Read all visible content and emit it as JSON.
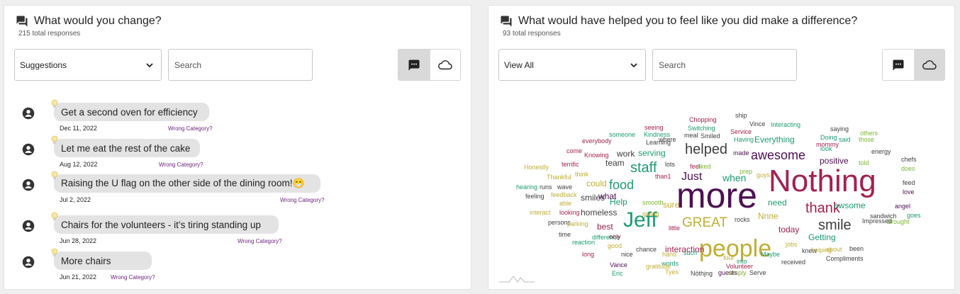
{
  "left_panel": {
    "title": "What would you change?",
    "subtitle": "215 total responses",
    "category_select": "Suggestions",
    "search_placeholder": "Search",
    "view_toggle": {
      "active": "list-view",
      "options": [
        "chat-bubble-icon",
        "cloud-icon"
      ]
    },
    "responses": [
      {
        "text": "Get a second oven for efficiency",
        "date": "Dec 11, 2022",
        "action": "Wrong Category?"
      },
      {
        "text": "Let me eat the rest of the cake",
        "date": "Aug 12, 2022",
        "action": "Wrong Category?"
      },
      {
        "text": "Raising the U flag on the other side of the dining room!😁",
        "date": "Jul 2, 2022",
        "action": "Wrong Category?"
      },
      {
        "text": "Chairs for the volunteers - it’s tiring standing up",
        "date": "Jun 28, 2022",
        "action": "Wrong Category?"
      },
      {
        "text": "More chairs",
        "date": "Jun 21, 2022",
        "action": "Wrong Category?"
      }
    ]
  },
  "right_panel": {
    "title": "What would have helped you to feel like you did make a difference?",
    "subtitle": "93 total responses",
    "category_select": "View All",
    "search_placeholder": "Search",
    "view_toggle": {
      "active": "cloud-view",
      "options": [
        "chat-bubble-icon",
        "cloud-icon"
      ]
    },
    "word_cloud": [
      {
        "w": "more",
        "c": "#4d0f52"
      },
      {
        "w": "Nothing",
        "c": "#a3204f"
      },
      {
        "w": "people",
        "c": "#bfae34"
      },
      {
        "w": "Jeff",
        "c": "#1b9a73"
      },
      {
        "w": "helped",
        "c": "#3d3d3d"
      },
      {
        "w": "staff",
        "c": "#1b9a73"
      },
      {
        "w": "awesome",
        "c": "#4d0f52"
      },
      {
        "w": "food",
        "c": "#1b9a73"
      },
      {
        "w": "GREAT",
        "c": "#bfae34"
      },
      {
        "w": "thank",
        "c": "#a3204f"
      },
      {
        "w": "smile",
        "c": "#3d3d3d"
      },
      {
        "w": "Just",
        "c": "#4d0f52"
      },
      {
        "w": "when",
        "c": "#1b9a73"
      },
      {
        "w": "positive",
        "c": "#4d0f52"
      },
      {
        "w": "Everything",
        "c": "#1b9a73"
      },
      {
        "w": "work",
        "c": "#3d3d3d"
      },
      {
        "w": "serving",
        "c": "#1b9a73"
      },
      {
        "w": "team",
        "c": "#3d3d3d"
      },
      {
        "w": "could",
        "c": "#bfae34"
      },
      {
        "w": "smiles",
        "c": "#3d3d3d"
      },
      {
        "w": "homeless",
        "c": "#3d3d3d"
      },
      {
        "w": "Help",
        "c": "#1b9a73"
      },
      {
        "w": "what",
        "c": "#4d0f52"
      },
      {
        "w": "sure",
        "c": "#bfae34"
      },
      {
        "w": "best",
        "c": "#a3204f"
      },
      {
        "w": "interaction",
        "c": "#a3204f"
      },
      {
        "w": "need",
        "c": "#1b9a73"
      },
      {
        "w": "Nnne",
        "c": "#bfae34"
      },
      {
        "w": "today",
        "c": "#a3204f"
      },
      {
        "w": "awsome",
        "c": "#1b9a73"
      },
      {
        "w": "Getting",
        "c": "#1b9a73"
      },
      {
        "w": "Chopping",
        "c": "#a3204f"
      },
      {
        "w": "Switching",
        "c": "#1b9a73"
      },
      {
        "w": "seeing",
        "c": "#a3204f"
      },
      {
        "w": "someone",
        "c": "#1b9a73"
      },
      {
        "w": "Kindness",
        "c": "#1b9a73"
      },
      {
        "w": "Learning",
        "c": "#3d3d3d"
      },
      {
        "w": "where",
        "c": "#3d3d3d"
      },
      {
        "w": "meal",
        "c": "#3d3d3d"
      },
      {
        "w": "everybody",
        "c": "#a3204f"
      },
      {
        "w": "come",
        "c": "#a3204f"
      },
      {
        "w": "Knowing",
        "c": "#a3204f"
      },
      {
        "w": "Smiled",
        "c": "#3d3d3d"
      },
      {
        "w": "ship",
        "c": "#3d3d3d"
      },
      {
        "w": "Vince",
        "c": "#3d3d3d"
      },
      {
        "w": "Service",
        "c": "#a3204f"
      },
      {
        "w": "Having",
        "c": "#1b9a73"
      },
      {
        "w": "made",
        "c": "#4d0f52"
      },
      {
        "w": "Interacting",
        "c": "#1b9a73"
      },
      {
        "w": "saying",
        "c": "#3d3d3d"
      },
      {
        "w": "Doing",
        "c": "#1b9a73"
      },
      {
        "w": "mommy",
        "c": "#a3204f"
      },
      {
        "w": "others",
        "c": "#7ab530"
      },
      {
        "w": "said",
        "c": "#1b9a73"
      },
      {
        "w": "those",
        "c": "#7ab530"
      },
      {
        "w": "look",
        "c": "#1b9a73"
      },
      {
        "w": "energy",
        "c": "#3d3d3d"
      },
      {
        "w": "told",
        "c": "#7ab530"
      },
      {
        "w": "chefs",
        "c": "#3d3d3d"
      },
      {
        "w": "does",
        "c": "#7ab530"
      },
      {
        "w": "Honestly",
        "c": "#bfae34"
      },
      {
        "w": "terrific",
        "c": "#a3204f"
      },
      {
        "w": "think",
        "c": "#bfae34"
      },
      {
        "w": "Thankful",
        "c": "#bfae34"
      },
      {
        "w": "lots",
        "c": "#3d3d3d"
      },
      {
        "w": "feel",
        "c": "#a3204f"
      },
      {
        "w": "liked",
        "c": "#7ab530"
      },
      {
        "w": "than1",
        "c": "#a3204f"
      },
      {
        "w": "prep",
        "c": "#7ab530"
      },
      {
        "w": "guys",
        "c": "#bfae34"
      },
      {
        "w": "hearing",
        "c": "#1b9a73"
      },
      {
        "w": "runs",
        "c": "#3d3d3d"
      },
      {
        "w": "wave",
        "c": "#3d3d3d"
      },
      {
        "w": "feeling",
        "c": "#3d3d3d"
      },
      {
        "w": "feedback",
        "c": "#bfae34"
      },
      {
        "w": "able",
        "c": "#bfae34"
      },
      {
        "w": "smooth",
        "c": "#7ab530"
      },
      {
        "w": "interact",
        "c": "#bfae34"
      },
      {
        "w": "looking",
        "c": "#a3204f"
      },
      {
        "w": "giving",
        "c": "#bfae34"
      },
      {
        "w": "persons",
        "c": "#3d3d3d"
      },
      {
        "w": "parking",
        "c": "#bfae34"
      },
      {
        "w": "time",
        "c": "#3d3d3d"
      },
      {
        "w": "difference",
        "c": "#1b9a73"
      },
      {
        "w": "only",
        "c": "#a3204f"
      },
      {
        "w": "little",
        "c": "#a3204f"
      },
      {
        "w": "rocks",
        "c": "#3d3d3d"
      },
      {
        "w": "reaction",
        "c": "#1b9a73"
      },
      {
        "w": "good",
        "c": "#bfae34"
      },
      {
        "w": "chance",
        "c": "#3d3d3d"
      },
      {
        "w": "long",
        "c": "#a3204f"
      },
      {
        "w": "nice",
        "c": "#3d3d3d"
      },
      {
        "w": "hand",
        "c": "#bfae34"
      },
      {
        "w": "such",
        "c": "#1b9a73"
      },
      {
        "w": "four",
        "c": "#bfae34"
      },
      {
        "w": "jobs",
        "c": "#bfae34"
      },
      {
        "w": "knew",
        "c": "#3d3d3d"
      },
      {
        "w": "helping",
        "c": "#bfae34"
      },
      {
        "w": "about",
        "c": "#bfae34"
      },
      {
        "w": "been",
        "c": "#3d3d3d"
      },
      {
        "w": "Maybe",
        "c": "#1b9a73"
      },
      {
        "w": "into",
        "c": "#1b9a73"
      },
      {
        "w": "words",
        "c": "#1b9a73"
      },
      {
        "w": "gratitude",
        "c": "#bfae34"
      },
      {
        "w": "Vance",
        "c": "#4d0f52"
      },
      {
        "w": "Eric",
        "c": "#1b9a73"
      },
      {
        "w": "Tyes",
        "c": "#bfae34"
      },
      {
        "w": "Volunteer",
        "c": "#a3204f"
      },
      {
        "w": "guests",
        "c": "#4d0f52"
      },
      {
        "w": "Nöthįng",
        "c": "#3d3d3d"
      },
      {
        "w": "simply",
        "c": "#7ab530"
      },
      {
        "w": "Serve",
        "c": "#3d3d3d"
      },
      {
        "w": "received",
        "c": "#3d3d3d"
      },
      {
        "w": "Compliments",
        "c": "#3d3d3d"
      },
      {
        "w": "feed",
        "c": "#3d3d3d"
      },
      {
        "w": "love",
        "c": "#4d0f52"
      },
      {
        "w": "angel",
        "c": "#4d0f52"
      },
      {
        "w": "goes",
        "c": "#1b9a73"
      },
      {
        "w": "sandwich",
        "c": "#3d3d3d"
      },
      {
        "w": "Brought",
        "c": "#7ab530"
      },
      {
        "w": "Impressed",
        "c": "#3d3d3d"
      }
    ]
  }
}
